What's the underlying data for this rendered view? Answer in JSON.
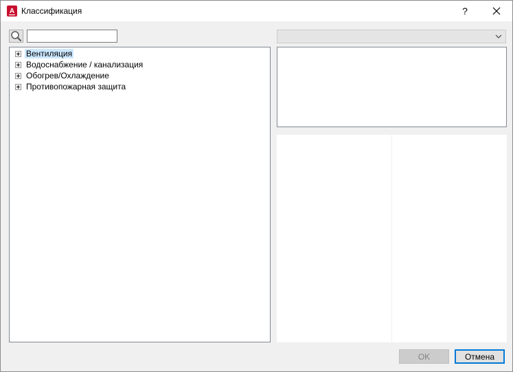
{
  "window": {
    "title": "Классификация",
    "help_label": "?",
    "close_label": "✕",
    "app_icon_letter": "A"
  },
  "search": {
    "value": "",
    "placeholder": ""
  },
  "tree": {
    "items": [
      {
        "label": "Вентиляция",
        "selected": true
      },
      {
        "label": "Водоснабжение / канализация",
        "selected": false
      },
      {
        "label": "Обогрев/Охлаждение",
        "selected": false
      },
      {
        "label": "Противопожарная защита",
        "selected": false
      }
    ]
  },
  "dropdown": {
    "value": ""
  },
  "buttons": {
    "ok_label": "OK",
    "cancel_label": "Отмена"
  },
  "colors": {
    "accent": "#0078d7",
    "app_icon": "#c8102e",
    "selection": "#cce8ff"
  }
}
